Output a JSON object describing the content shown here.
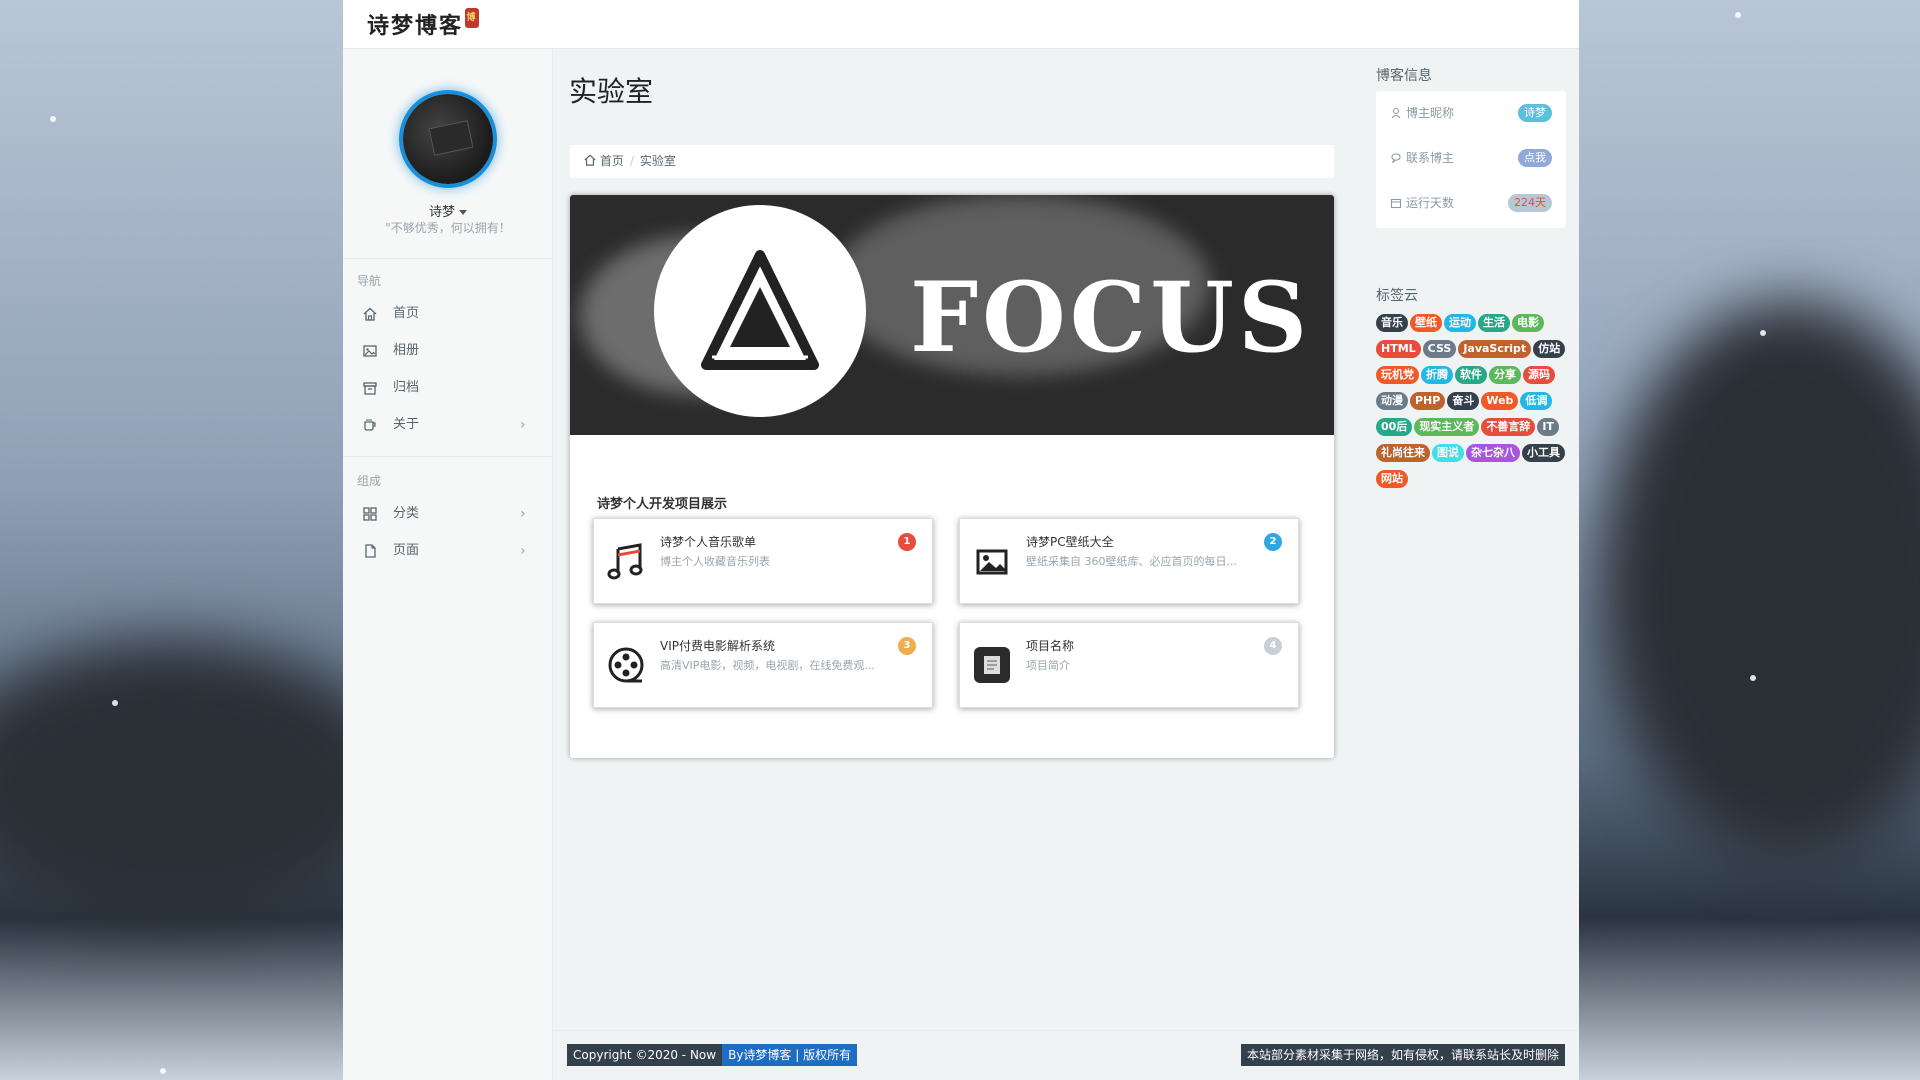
{
  "header": {
    "logo_text": "诗梦博客",
    "logo_badge": "博"
  },
  "sidebar": {
    "author_name": "诗梦",
    "motto": "\"不够优秀，何以拥有！",
    "nav_header": "导航",
    "nav_items": [
      {
        "label": "首页",
        "icon": "home-icon"
      },
      {
        "label": "相册",
        "icon": "image-icon"
      },
      {
        "label": "归档",
        "icon": "archive-icon"
      },
      {
        "label": "关于",
        "icon": "cup-icon",
        "has_arrow": true
      }
    ],
    "group_header": "组成",
    "group_items": [
      {
        "label": "分类",
        "icon": "grid-icon",
        "has_arrow": true
      },
      {
        "label": "页面",
        "icon": "file-icon",
        "has_arrow": true
      }
    ],
    "arrow": "›"
  },
  "main": {
    "page_title": "实验室",
    "breadcrumb": {
      "home": "首页",
      "current": "实验室",
      "separator": "/"
    },
    "banner_text": "FOCUS",
    "section_title": "诗梦个人开发项目展示",
    "projects": [
      {
        "name": "诗梦个人音乐歌单",
        "desc": "博主个人收藏音乐列表",
        "badge": "1",
        "badge_color": "#e74c3c",
        "icon": "music-icon"
      },
      {
        "name": "诗梦PC壁纸大全",
        "desc": "壁纸采集自 360壁纸库、必应首页的每日...",
        "badge": "2",
        "badge_color": "#2ea8e0",
        "icon": "picture-icon"
      },
      {
        "name": "VIP付费电影解析系统",
        "desc": "高清VIP电影，视频，电视剧，在线免费观...",
        "badge": "3",
        "badge_color": "#f0ad4e",
        "icon": "film-reel-icon"
      },
      {
        "name": "项目名称",
        "desc": "项目简介",
        "badge": "4",
        "badge_color": "#c8d0d6",
        "icon": "box-icon"
      }
    ]
  },
  "right": {
    "blog_info_title": "博客信息",
    "info": [
      {
        "label": "博主昵称",
        "value": "诗梦",
        "color": "#5bc0de",
        "icon": "user-icon"
      },
      {
        "label": "联系博主",
        "value": "点我",
        "color": "#8fa9d9",
        "icon": "chat-icon"
      },
      {
        "label": "运行天数",
        "value": "224天",
        "color": "#b9c7d4",
        "icon": "calendar-icon",
        "value_color": "#e74c3c"
      }
    ],
    "tag_cloud_title": "标签云",
    "tags": [
      {
        "text": "音乐",
        "color": "#35404d"
      },
      {
        "text": "壁纸",
        "color": "#f05a28"
      },
      {
        "text": "运动",
        "color": "#23b7e5"
      },
      {
        "text": "生活",
        "color": "#27a887"
      },
      {
        "text": "电影",
        "color": "#5cb85c"
      },
      {
        "text": "HTML",
        "color": "#e74c3c"
      },
      {
        "text": "CSS",
        "color": "#6b7b8a"
      },
      {
        "text": "JavaScript",
        "color": "#c0622d"
      },
      {
        "text": "仿站",
        "color": "#35404d"
      },
      {
        "text": "玩机党",
        "color": "#f05a28"
      },
      {
        "text": "折腾",
        "color": "#23b7e5"
      },
      {
        "text": "软件",
        "color": "#27a887"
      },
      {
        "text": "分享",
        "color": "#5cb85c"
      },
      {
        "text": "源码",
        "color": "#e74c3c"
      },
      {
        "text": "动漫",
        "color": "#6b7b8a"
      },
      {
        "text": "PHP",
        "color": "#c0622d"
      },
      {
        "text": "奋斗",
        "color": "#35404d"
      },
      {
        "text": "Web",
        "color": "#f05a28"
      },
      {
        "text": "低调",
        "color": "#23b7e5"
      },
      {
        "text": "00后",
        "color": "#27a887"
      },
      {
        "text": "现实主义者",
        "color": "#5cb85c"
      },
      {
        "text": "不善言辞",
        "color": "#e74c3c"
      },
      {
        "text": "IT",
        "color": "#6b7b8a"
      },
      {
        "text": "礼尚往来",
        "color": "#c0622d"
      },
      {
        "text": "图说",
        "color": "#3ee0e8"
      },
      {
        "text": "杂七杂八",
        "color": "#a855e0"
      },
      {
        "text": "小工具",
        "color": "#35404d"
      },
      {
        "text": "网站",
        "color": "#f05a28"
      }
    ]
  },
  "footer": {
    "copyright": "Copyright ©2020 - Now",
    "owner": "By诗梦博客 | 版权所有",
    "notice": "本站部分素材采集于网络，如有侵权，请联系站长及时删除"
  }
}
